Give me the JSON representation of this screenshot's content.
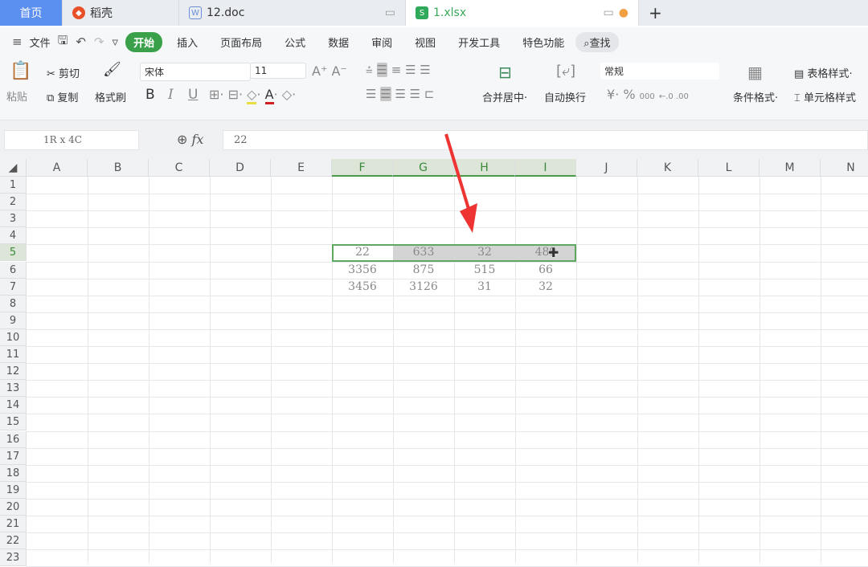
{
  "tabs": [
    {
      "label": "首页"
    },
    {
      "label": "稻壳",
      "icon": "daoke-icon"
    },
    {
      "label": "12.doc",
      "icon": "word-icon"
    },
    {
      "label": "1.xlsx",
      "icon": "sheet-icon",
      "active": true
    }
  ],
  "menu": {
    "file": "文件",
    "items": [
      "开始",
      "插入",
      "页面布局",
      "公式",
      "数据",
      "审阅",
      "视图",
      "开发工具",
      "特色功能"
    ],
    "find": "查找"
  },
  "ribbon": {
    "paste": "粘贴",
    "cut": "剪切",
    "copy": "复制",
    "format_painter": "格式刷",
    "font": "宋体",
    "size": "11",
    "bold": "B",
    "italic": "I",
    "underline": "U",
    "merge": "合并居中",
    "wrap": "自动换行",
    "number_format": "常规",
    "currency": "¥",
    "percent": "%",
    "thousands": "000",
    "cond_format": "条件格式",
    "table_style": "表格样式",
    "cell_style": "单元格样式"
  },
  "formula_bar": {
    "name_box": "1R x 4C",
    "fx": "fx",
    "value": "22"
  },
  "accent": "#3aa14a",
  "sheet": {
    "columns": [
      "A",
      "B",
      "C",
      "D",
      "E",
      "F",
      "G",
      "H",
      "I",
      "J",
      "K",
      "L",
      "M",
      "N"
    ],
    "rows": [
      "1",
      "2",
      "3",
      "4",
      "5",
      "6",
      "7",
      "8",
      "9",
      "10",
      "11",
      "12",
      "13",
      "14",
      "15",
      "16",
      "17",
      "18",
      "19",
      "20",
      "21",
      "22",
      "23"
    ],
    "cells": [
      {
        "ref": "F5",
        "value": "22"
      },
      {
        "ref": "G5",
        "value": "633"
      },
      {
        "ref": "H5",
        "value": "32"
      },
      {
        "ref": "I5",
        "value": "489"
      },
      {
        "ref": "F6",
        "value": "3356"
      },
      {
        "ref": "G6",
        "value": "875"
      },
      {
        "ref": "H6",
        "value": "515"
      },
      {
        "ref": "I6",
        "value": "66"
      },
      {
        "ref": "F7",
        "value": "3456"
      },
      {
        "ref": "G7",
        "value": "3126"
      },
      {
        "ref": "H7",
        "value": "31"
      },
      {
        "ref": "I7",
        "value": "32"
      }
    ],
    "selection": "F5:I5"
  }
}
